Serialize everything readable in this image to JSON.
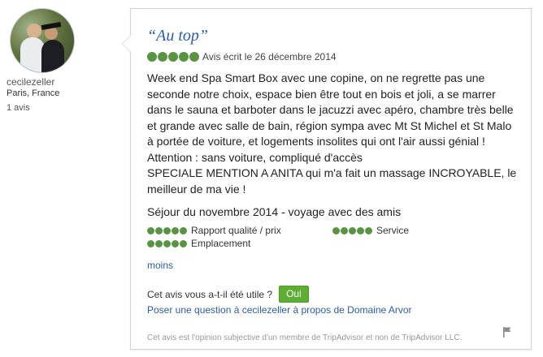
{
  "reviewer": {
    "username": "cecilezeller",
    "location": "Paris, France",
    "review_count": "1 avis"
  },
  "review": {
    "title": "“Au top”",
    "rating_bubbles": 5,
    "date_text": "Avis écrit le 26 décembre 2014",
    "body": "Week end Spa Smart Box avec une copine, on ne regrette pas une seconde notre choix, espace bien être tout en bois et joli, a se marrer dans le sauna et barboter dans le jacuzzi avec apéro, chambre très belle et grande avec salle de bain, région sympa avec Mt St Michel et St Malo à portée de voiture, et logements insolites qui ont l'air aussi génial !\nAttention : sans voiture, compliqué d'accès\nSPECIALE MENTION A ANITA qui m'a fait un massage INCROYABLE, le meilleur de ma vie !",
    "stay": "Séjour du novembre 2014 - voyage avec des amis",
    "ratings": [
      {
        "label": "Rapport qualité / prix",
        "bubbles": 5
      },
      {
        "label": "Service",
        "bubbles": 5
      },
      {
        "label": "Emplacement",
        "bubbles": 5
      }
    ],
    "less_link": "moins",
    "helpful_question": "Cet avis vous a-t-il été utile ?",
    "helpful_button": "Oui",
    "ask_link": "Poser une question à cecilezeller à propos de Domaine Arvor",
    "disclaimer": "Cet avis est l'opinion subjective d'un membre de TripAdvisor et non de TripAdvisor LLC."
  },
  "colors": {
    "link": "#2c5da8",
    "bubble_green": "#589442",
    "button_green": "#5eae35"
  },
  "icons": [
    "avatar-photo",
    "rating-bubble",
    "flag-icon"
  ]
}
